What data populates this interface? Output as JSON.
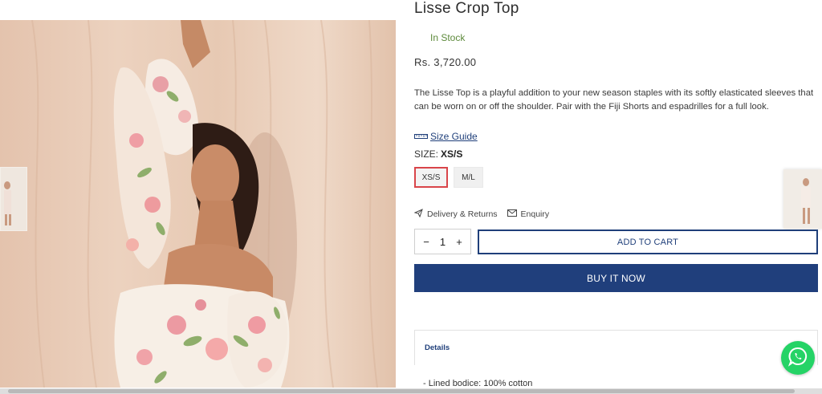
{
  "product": {
    "title": "Lisse Crop Top",
    "stock": "In Stock",
    "price": "Rs. 3,720.00",
    "description": "The Lisse Top is a playful addition to your new season staples with its softly elasticated sleeves that can be worn on or off the shoulder. Pair with the Fiji Shorts and espadrilles for a full look."
  },
  "size": {
    "guide_label": "Size Guide",
    "label": "SIZE:",
    "selected": "XS/S",
    "options": [
      "XS/S",
      "M/L"
    ]
  },
  "links": {
    "delivery": "Delivery & Returns",
    "enquiry": "Enquiry"
  },
  "cart": {
    "minus": "−",
    "quantity": "1",
    "plus": "+",
    "add_label": "ADD TO CART",
    "buy_label": "BUY IT NOW"
  },
  "details": {
    "heading": "Details",
    "first_line": "- Lined bodice: 100% cotton"
  },
  "icons": {
    "ruler": "ruler-icon",
    "truck": "paper-plane-icon",
    "mail": "envelope-icon",
    "whatsapp": "whatsapp-icon"
  },
  "colors": {
    "accent": "#203f7c",
    "stock": "#5d8a3b",
    "selected_border": "#d9454a",
    "whatsapp": "#25d366"
  }
}
